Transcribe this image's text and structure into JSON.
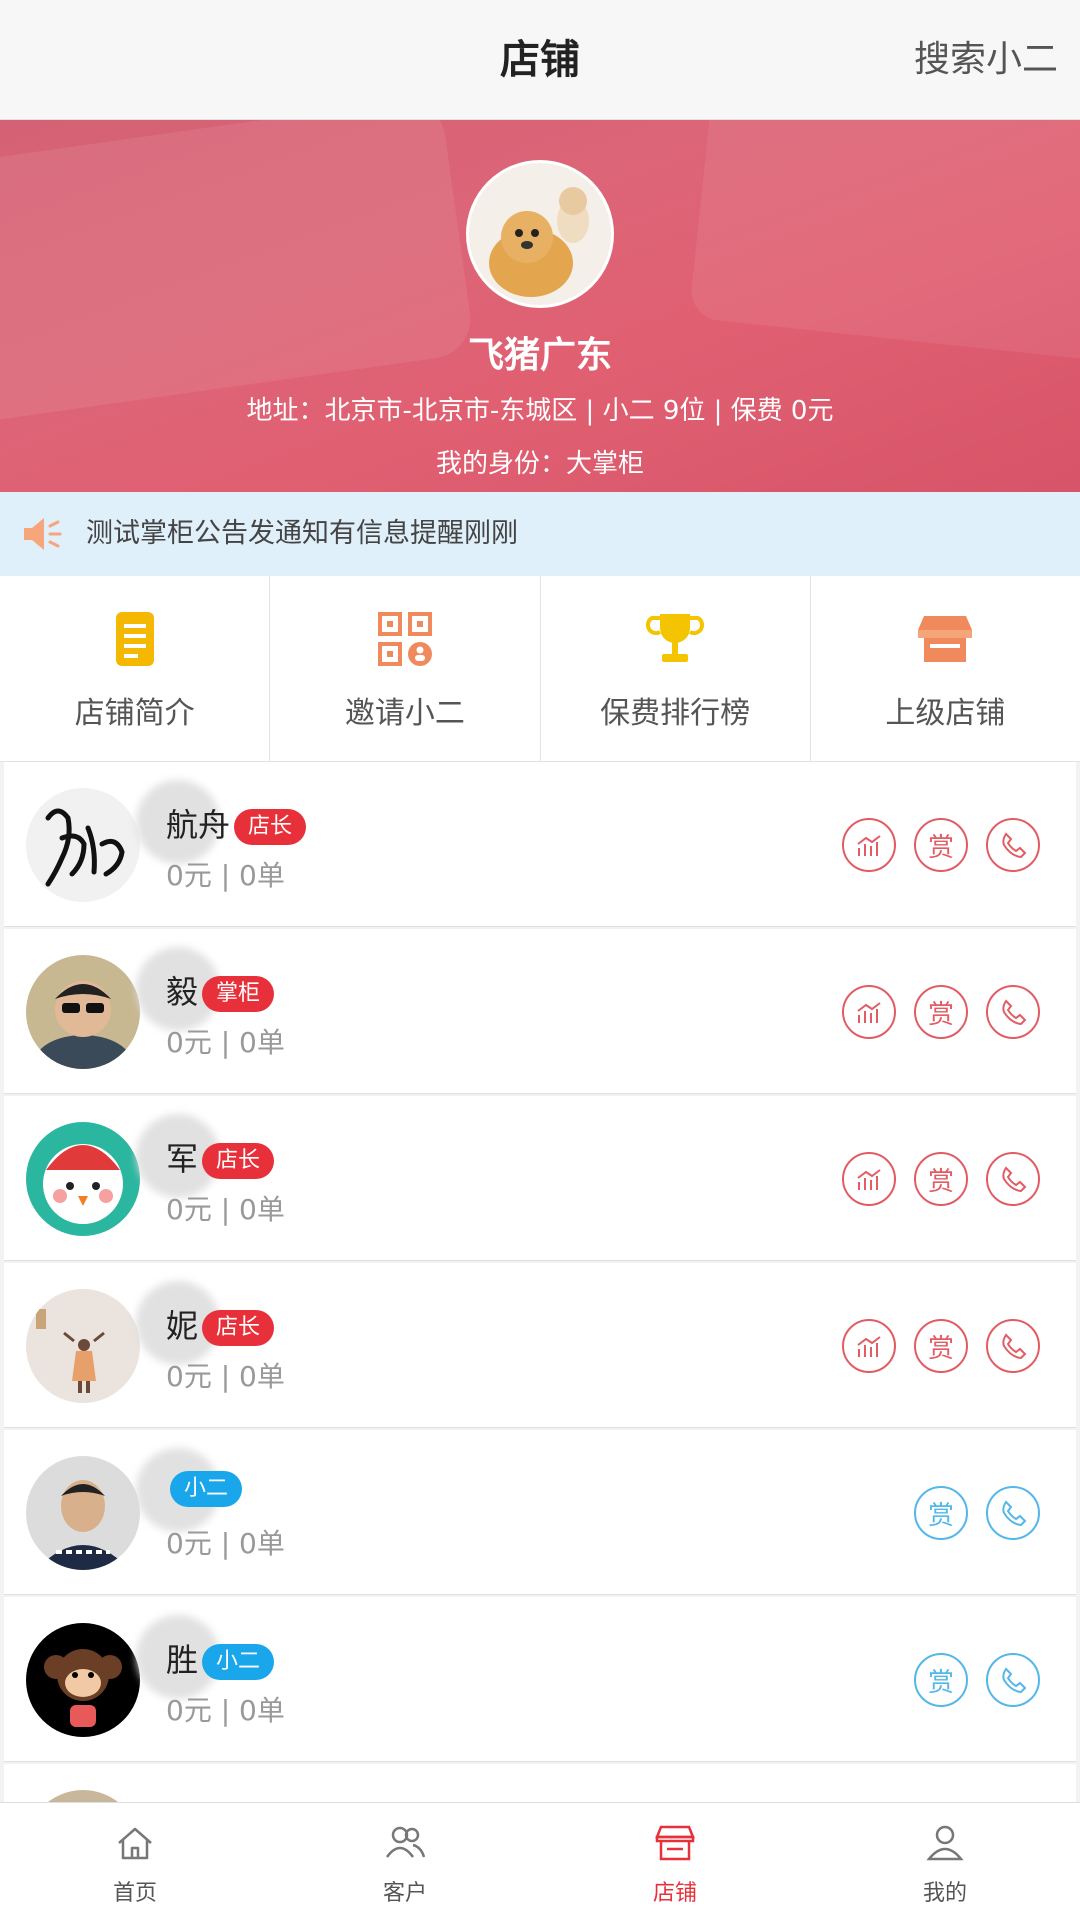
{
  "header": {
    "title": "店铺",
    "search_label": "搜索小二"
  },
  "shop": {
    "name": "飞猪广东",
    "info": "地址：北京市-北京市-东城区 | 小二 9位 | 保费 0元",
    "role": "我的身份：大掌柜"
  },
  "notice": {
    "text": "测试掌柜公告发通知有信息提醒刚刚",
    "icon": "speaker-icon"
  },
  "quick_menu": [
    {
      "label": "店铺简介",
      "icon": "document-icon",
      "color": "#f5b800"
    },
    {
      "label": "邀请小二",
      "icon": "qr-invite-icon",
      "color": "#f08a5d"
    },
    {
      "label": "保费排行榜",
      "icon": "trophy-icon",
      "color": "#f5c400"
    },
    {
      "label": "上级店铺",
      "icon": "store-icon",
      "color": "#f08a5d"
    }
  ],
  "members": [
    {
      "name": "航舟",
      "badge": "店长",
      "badge_color": "red",
      "stats": "0元 | 0单"
    },
    {
      "name": "毅",
      "badge": "掌柜",
      "badge_color": "red",
      "stats": "0元 | 0单"
    },
    {
      "name": "军",
      "badge": "店长",
      "badge_color": "red",
      "stats": "0元 | 0单"
    },
    {
      "name": "妮",
      "badge": "店长",
      "badge_color": "red",
      "stats": "0元 | 0单"
    },
    {
      "name": "",
      "badge": "小二",
      "badge_color": "blue",
      "stats": "0元 | 0单"
    },
    {
      "name": "胜",
      "badge": "小二",
      "badge_color": "blue",
      "stats": "0元 | 0单"
    }
  ],
  "actions": {
    "reward": "赏"
  },
  "bottom_nav": [
    {
      "label": "首页",
      "icon": "home-icon"
    },
    {
      "label": "客户",
      "icon": "customers-icon"
    },
    {
      "label": "店铺",
      "icon": "store-icon",
      "active": true
    },
    {
      "label": "我的",
      "icon": "profile-icon"
    }
  ],
  "colors": {
    "accent_red": "#e8303a",
    "accent_blue": "#1aa6ea",
    "notice_bg": "#dff0fa"
  }
}
